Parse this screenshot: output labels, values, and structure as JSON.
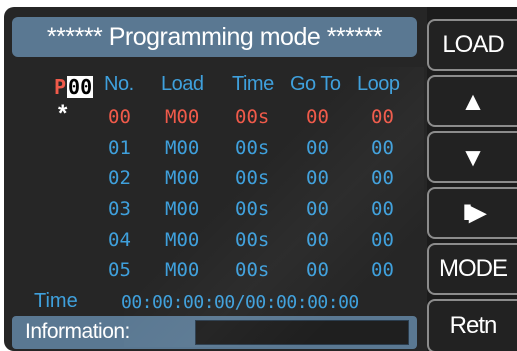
{
  "title": "****** Programming mode ******",
  "program": {
    "prefix": "P",
    "number": "00"
  },
  "current_marker": "*",
  "columns": [
    "No.",
    "Load",
    "Time",
    "Go To",
    "Loop"
  ],
  "rows": [
    {
      "no": "00",
      "load": "M00",
      "time": "00s",
      "goto": "00",
      "loop": "00",
      "active": true
    },
    {
      "no": "01",
      "load": "M00",
      "time": "00s",
      "goto": "00",
      "loop": "00",
      "active": false
    },
    {
      "no": "02",
      "load": "M00",
      "time": "00s",
      "goto": "00",
      "loop": "00",
      "active": false
    },
    {
      "no": "03",
      "load": "M00",
      "time": "00s",
      "goto": "00",
      "loop": "00",
      "active": false
    },
    {
      "no": "04",
      "load": "M00",
      "time": "00s",
      "goto": "00",
      "loop": "00",
      "active": false
    },
    {
      "no": "05",
      "load": "M00",
      "time": "00s",
      "goto": "00",
      "loop": "00",
      "active": false
    }
  ],
  "time": {
    "label": "Time",
    "value": "00:00:00:00/00:00:00:00"
  },
  "information": {
    "label": "Information:",
    "value": ""
  },
  "side_buttons": {
    "load": "LOAD",
    "up_icon": "up-triangle",
    "down_icon": "down-triangle",
    "pause_play_icon": "pause-play",
    "mode": "MODE",
    "retn": "Retn"
  },
  "colors": {
    "background": "#262626",
    "header_bar": "#5a7892",
    "accent_blue": "#3fa0dc",
    "active_red": "#f05a4a",
    "button_border": "#8c8c8c"
  }
}
